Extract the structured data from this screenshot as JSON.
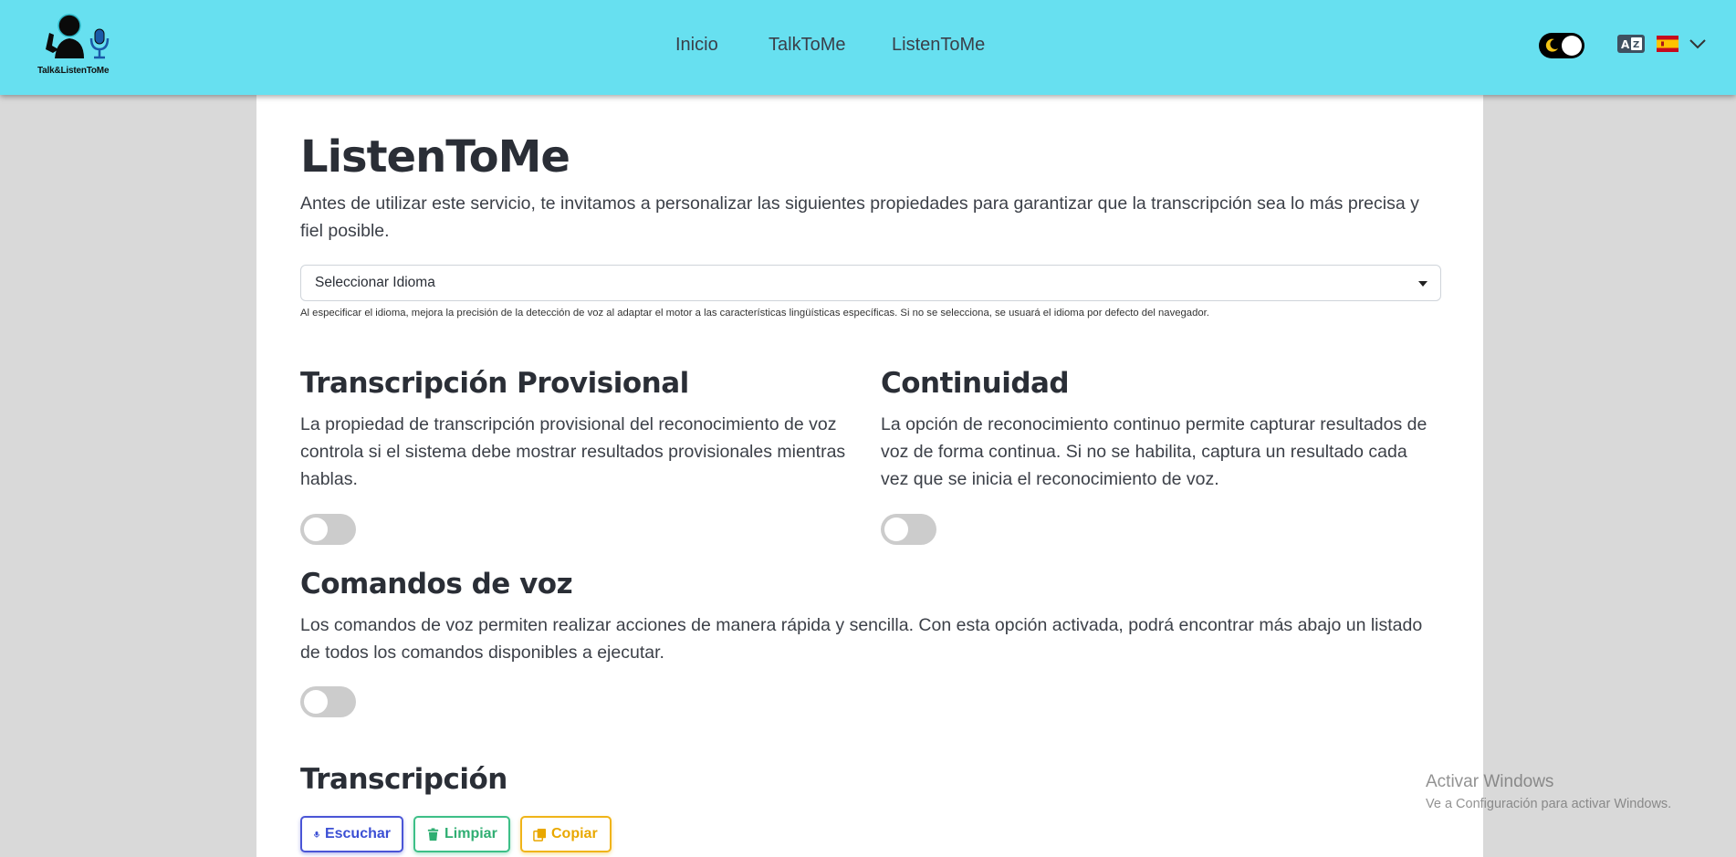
{
  "nav": {
    "logo_text": "Talk&ListenToMe",
    "links": [
      "Inicio",
      "TalkToMe",
      "ListenToMe"
    ],
    "language_flag": "es-flag-icon",
    "theme_icon": "moon-icon"
  },
  "main": {
    "title": "ListenToMe",
    "intro": "Antes de utilizar este servicio, te invitamos a personalizar las siguientes propiedades para garantizar que la transcripción sea lo más precisa y fiel posible.",
    "language_select": {
      "value": "Seleccionar Idioma",
      "help": "Al especificar el idioma, mejora la precisión de la detección de voz al adaptar el motor a las características lingüísticas específicas. Si no se selecciona, se usuará el idioma por defecto del navegador."
    },
    "interim": {
      "title": "Transcripción Provisional",
      "description": "La propiedad de transcripción provisional del reconocimiento de voz controla si el sistema debe mostrar resultados provisionales mientras hablas.",
      "enabled": false
    },
    "continuous": {
      "title": "Continuidad",
      "description": "La opción de reconocimiento continuo permite capturar resultados de voz de forma continua. Si no se habilita, captura un resultado cada vez que se inicia el reconocimiento de voz.",
      "enabled": false
    },
    "commands": {
      "title": "Comandos de voz",
      "description": "Los comandos de voz permiten realizar acciones de manera rápida y sencilla. Con esta opción activada, podrá encontrar más abajo un listado de todos los comandos disponibles a ejecutar.",
      "enabled": false
    },
    "transcription": {
      "title": "Transcripción",
      "buttons": {
        "listen": "Escuchar",
        "clear": "Limpiar",
        "copy": "Copiar"
      }
    }
  },
  "watermark": {
    "title": "Activar Windows",
    "subtitle": "Ve a Configuración para activar Windows."
  },
  "colors": {
    "navbar": "#67e0f0",
    "background": "#d9d9d9",
    "listen": "#4a55d6",
    "clear": "#3dbf87",
    "copy": "#f0b419"
  }
}
